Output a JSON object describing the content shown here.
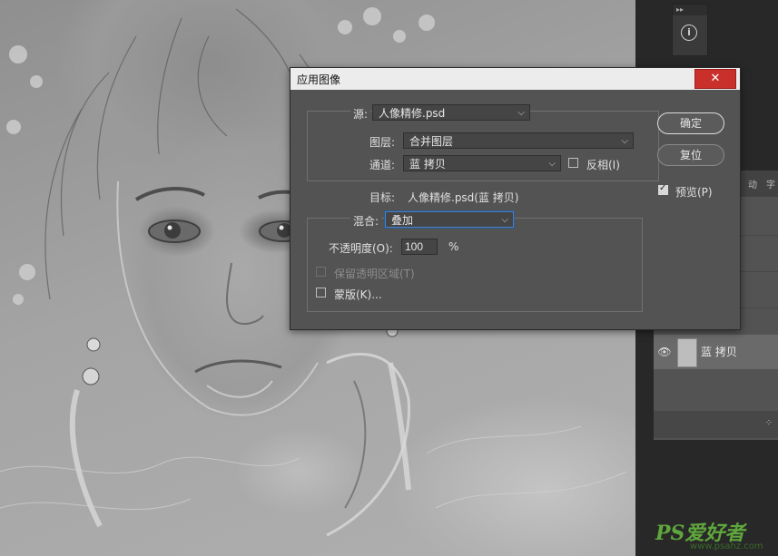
{
  "dialog": {
    "title": "应用图像",
    "close_label": "✕",
    "source": {
      "label": "源:",
      "file_value": "人像精修.psd",
      "layer_label": "图层:",
      "layer_value": "合并图层",
      "channel_label": "通道:",
      "channel_value": "蓝 拷贝",
      "invert_label": "反相(I)",
      "invert_checked": false
    },
    "target": {
      "label": "目标:",
      "value": "人像精修.psd(蓝 拷贝)"
    },
    "blending": {
      "label": "混合:",
      "mode_value": "叠加",
      "opacity_label": "不透明度(O):",
      "opacity_value": "100",
      "opacity_unit": "%",
      "preserve_transparency_label": "保留透明区域(T)",
      "preserve_transparency_enabled": false,
      "mask_label": "蒙版(K)..."
    },
    "buttons": {
      "ok": "确定",
      "reset": "复位"
    },
    "preview_label": "预览(P)",
    "preview_checked": true
  },
  "layers_panel": {
    "header_tabs": [
      "动",
      "字"
    ],
    "layer_name": "蓝 拷贝"
  },
  "mini_panel": {
    "collapse_label": "▸▸",
    "info_icon": "info-icon"
  },
  "watermark": {
    "logo": "PS爱好者",
    "url": "www.psahz.com"
  }
}
